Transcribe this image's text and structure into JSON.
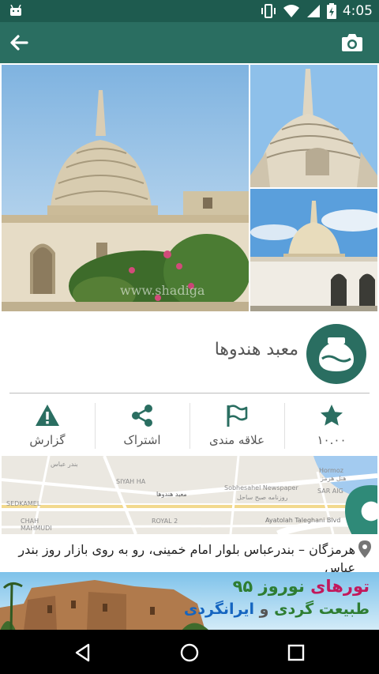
{
  "status_bar": {
    "time": "4:05",
    "icons": [
      "android-icon",
      "vibrate-icon",
      "wifi-icon",
      "cell-signal-icon",
      "battery-charging-icon"
    ]
  },
  "app_bar": {
    "back_icon": "arrow-left-icon",
    "camera_icon": "camera-icon",
    "color": "#2a6e61"
  },
  "gallery": {
    "watermark": "www.shadiga",
    "photos": [
      "temple-main-photo",
      "temple-dome-closeup-photo",
      "temple-wide-photo"
    ]
  },
  "place": {
    "title": "معبد هندوها",
    "icon": "pottery-icon"
  },
  "actions": [
    {
      "name": "rating",
      "icon": "star-icon",
      "label": "۱۰.۰۰"
    },
    {
      "name": "favorite",
      "icon": "flag-icon",
      "label": "علاقه مندی"
    },
    {
      "name": "share",
      "icon": "share-icon",
      "label": "اشتراک"
    },
    {
      "name": "report",
      "icon": "warning-icon",
      "label": "گزارش"
    }
  ],
  "map": {
    "labels": {
      "bandar_abbas": "بندر عباس",
      "siyah_ha": "SIYAH HA",
      "hormoz": "Hormoz",
      "hormoz_fa": "هتل هرمز",
      "newspaper": "Sobhesahel Newspaper",
      "newspaper_fa": "روزنامه صبح ساحل",
      "sar_aig": "SAR AIG",
      "sedkamel": "SEDKAMEL",
      "chah_mahmudi": "CHAH\nMAHMUDI",
      "place_fa": "معبد هندوها",
      "royal": "ROYAL 2",
      "blvd": "Ayatolah Taleghani Blvd"
    },
    "marker_icon": "map-marker-icon"
  },
  "address": {
    "icon": "location-pin-icon",
    "text": "هرمزگان – بندرعباس بلوار امام خمینی، رو به روی بازار روز بندر عباس"
  },
  "banner": {
    "line1_a": "تورهای",
    "line1_b": "نوروز ۹۵",
    "line2_a": "طبیعت گردی",
    "line2_mid": "و",
    "line2_b": "ایرانگردی"
  },
  "nav_bar": {
    "icons": [
      "back-triangle-icon",
      "home-circle-icon",
      "recents-square-icon"
    ]
  }
}
